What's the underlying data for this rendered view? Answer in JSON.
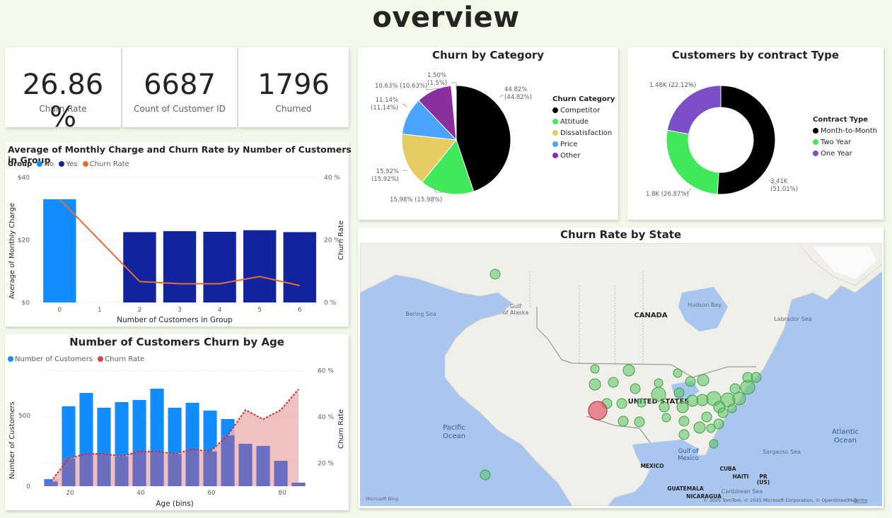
{
  "page": {
    "title": "overview"
  },
  "kpis": [
    {
      "value": "26.86 %",
      "label": "Churn Rate"
    },
    {
      "value": "6687",
      "label": "Count of Customer ID"
    },
    {
      "value": "1796",
      "label": "Churned"
    }
  ],
  "colors": {
    "no": "#118dff",
    "yes": "#12239e",
    "churn_line": "#e66c37",
    "age_area": "#d64550",
    "age_area_fill": "#efb6b7"
  },
  "combo": {
    "title": "Average of Monthly Charge and Churn Rate by Number of Customers in Group",
    "legend_title": "Group",
    "legend": [
      "No",
      "Yes",
      "Churn Rate"
    ],
    "xlabel": "Number of Customers in Group",
    "ylabel": "Average of Monthly Charge",
    "y2label": "Churn Rate",
    "y_ticks": [
      "$40",
      "$20",
      "$0"
    ],
    "y2_ticks": [
      "40 %",
      "20 %",
      "0 %"
    ],
    "x_ticks": [
      "0",
      "1",
      "2",
      "3",
      "4",
      "5",
      "6"
    ]
  },
  "age": {
    "title": "Number of Customers Churn by Age",
    "legend": [
      "Number of Customers",
      "Churn Rate"
    ],
    "xlabel": "Age (bins)",
    "ylabel": "Number of Customers",
    "y2label": "Churn Rate",
    "y_ticks": [
      "500",
      "0"
    ],
    "y2_ticks": [
      "60 %",
      "40 %",
      "20 %"
    ],
    "x_ticks": [
      "20",
      "40",
      "60",
      "80"
    ]
  },
  "category": {
    "title": "Churn by Category",
    "legend_title": "Churn Category",
    "items": [
      "Competitor",
      "Attitude",
      "Dissatisfaction",
      "Price",
      "Other"
    ],
    "colors": [
      "#000000",
      "#40e95a",
      "#e5cd64",
      "#4aa3ff",
      "#8b2fa0"
    ],
    "labels": [
      "44.82%\n(44.82%)",
      "15.98% (15.98%)",
      "15.92%\n(15.92%)",
      "11.14%\n(11.14%)",
      "10.63% (10.63%)",
      "1.50%\n(1.5%)"
    ]
  },
  "contract": {
    "title": "Customers by contract Type",
    "legend_title": "Contract Type",
    "items": [
      "Month-to-Month",
      "Two Year",
      "One Year"
    ],
    "colors": [
      "#000000",
      "#40e95a",
      "#7a4fc8"
    ],
    "labels": [
      "3.41K\n(51.01%)",
      "1.8K (26.87%)",
      "1.48K (22.12%)"
    ]
  },
  "map": {
    "title": "Churn Rate by State",
    "labels": [
      "Bering Sea",
      "Gulf\nof Alaska",
      "CANADA",
      "Hudson Bay",
      "Labrador Sea",
      "UNITED STATES",
      "Pacific\nOcean",
      "Atlantic\nOcean",
      "Gulf of\nMexico",
      "Sargasso Sea",
      "MEXICO",
      "CUBA",
      "HAITI",
      "PR\n(US)",
      "Caribbean Sea",
      "GUATEMALA",
      "NICARAGUA"
    ],
    "attribution": "© 2025 TomTom, © 2025 Microsoft Corporation, © OpenStreetMap",
    "terms": "Terms",
    "logo": "Microsoft Bing"
  },
  "chart_data": [
    {
      "type": "bar",
      "title": "Average of Monthly Charge and Churn Rate by Number of Customers in Group",
      "xlabel": "Number of Customers in Group",
      "ylabel": "Average of Monthly Charge",
      "y2label": "Churn Rate",
      "categories": [
        "0",
        "1",
        "2",
        "3",
        "4",
        "5",
        "6"
      ],
      "ylim": [
        0,
        40
      ],
      "y2lim": [
        0,
        40
      ],
      "series": [
        {
          "name": "No",
          "values": [
            33,
            null,
            null,
            null,
            null,
            null,
            null
          ]
        },
        {
          "name": "Yes",
          "values": [
            null,
            null,
            22.5,
            22.8,
            22.6,
            23.1,
            22.5
          ]
        },
        {
          "name": "Churn Rate",
          "type": "line",
          "values": [
            33,
            null,
            6.7,
            6,
            6,
            8.3,
            5.4
          ]
        }
      ],
      "legend_position": "top-left"
    },
    {
      "type": "bar",
      "title": "Number of Customers Churn by Age",
      "xlabel": "Age (bins)",
      "ylabel": "Number of Customers",
      "y2label": "Churn Rate",
      "x": [
        15,
        20,
        25,
        30,
        35,
        40,
        45,
        50,
        55,
        60,
        65,
        70,
        75,
        80,
        85
      ],
      "ylim": [
        0,
        850
      ],
      "y2lim": [
        10,
        62
      ],
      "series": [
        {
          "name": "Number of Customers",
          "values": [
            50,
            565,
            660,
            555,
            595,
            610,
            690,
            555,
            590,
            535,
            475,
            300,
            285,
            180,
            25
          ]
        },
        {
          "name": "Churn Rate",
          "type": "area",
          "values": [
            12,
            22,
            24,
            24,
            23,
            25,
            25,
            24,
            26,
            25,
            32,
            43,
            39,
            43,
            52
          ]
        }
      ],
      "legend_position": "top-left"
    },
    {
      "type": "pie",
      "title": "Churn by Category",
      "categories": [
        "Competitor",
        "Attitude",
        "Dissatisfaction",
        "Price",
        "Other"
      ],
      "values": [
        44.82,
        15.98,
        15.92,
        11.14,
        10.63,
        1.5
      ],
      "legend_position": "right"
    },
    {
      "type": "pie",
      "title": "Customers by contract Type",
      "categories": [
        "Month-to-Month",
        "Two Year",
        "One Year"
      ],
      "values": [
        51.01,
        26.87,
        22.12
      ],
      "legend_position": "right"
    }
  ]
}
